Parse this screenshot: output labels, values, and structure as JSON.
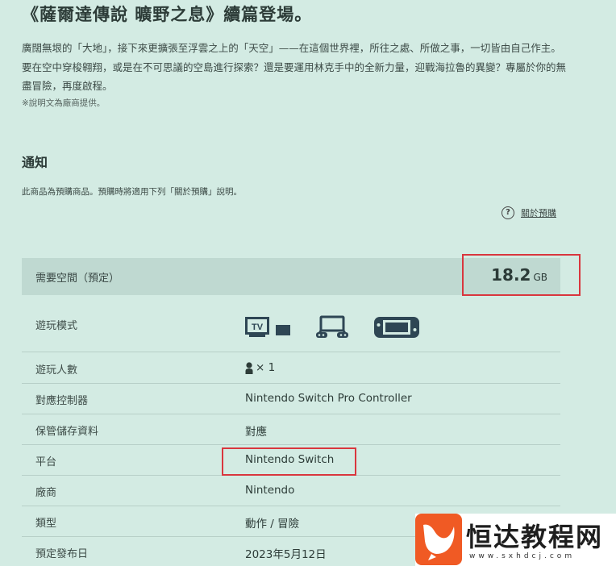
{
  "title": "《薩爾達傳說 曠野之息》續篇登場。",
  "description": "廣闊無垠的「大地」，接下來更擴張至浮雲之上的「天空」——在這個世界裡，所往之處、所做之事，一切皆由自己作主。要在空中穿梭翱翔，或是在不可思議的空島進行探索？還是要運用林克手中的全新力量，迎戰海拉魯的異變？專屬於你的無盡冒險，再度啟程。",
  "note": "※說明文為廠商提供。",
  "notice": {
    "title": "通知",
    "text": "此商品為預購商品。預購時將適用下列「關於預購」說明。",
    "link": "關於預購",
    "link_icon": "question-circle-icon"
  },
  "space": {
    "label": "需要空間（預定）",
    "value": "18.2",
    "unit": "GB"
  },
  "info": {
    "play_mode_label": "遊玩模式",
    "play_mode_icons": [
      "tv-mode-icon",
      "tabletop-mode-icon",
      "handheld-mode-icon"
    ],
    "tv_text": "TV",
    "players_label": "遊玩人數",
    "players_value": "× 1",
    "controller_label": "對應控制器",
    "controller_value": "Nintendo Switch Pro Controller",
    "save_label": "保管儲存資料",
    "save_value": "對應",
    "platform_label": "平台",
    "platform_value": "Nintendo Switch",
    "publisher_label": "廠商",
    "publisher_value": "Nintendo",
    "genre_label": "類型",
    "genre_value": "動作 / 冒險",
    "release_label": "預定發布日",
    "release_value": "2023年5月12日"
  },
  "watermark": {
    "text": "恒达教程网",
    "url": "www.sxhdcj.com"
  },
  "colors": {
    "background": "#d3ebe3",
    "highlight_box": "#d9363e",
    "watermark_logo": "#f05a24"
  }
}
